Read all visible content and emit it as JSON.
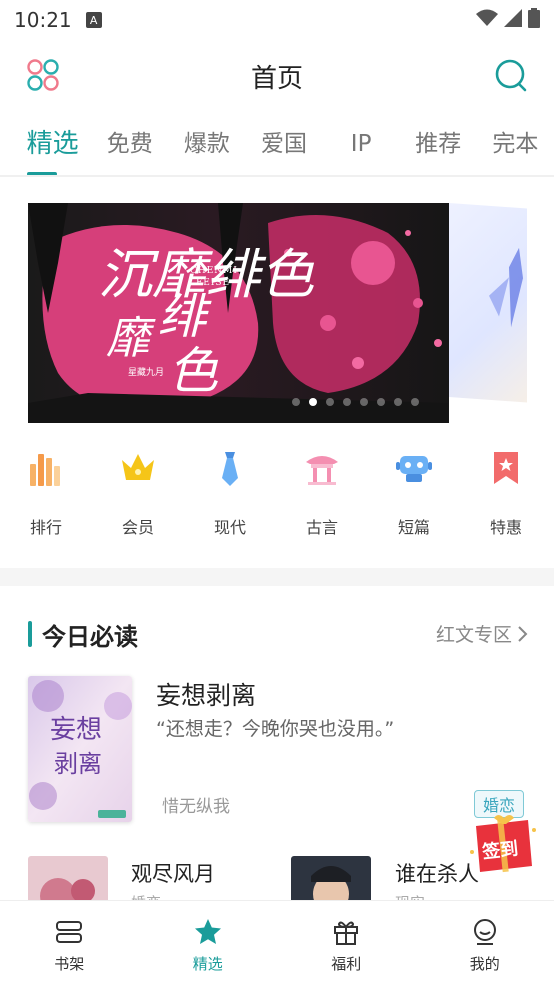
{
  "status": {
    "time": "10:21",
    "a_badge": "A"
  },
  "header": {
    "title": "首页"
  },
  "tabs": [
    {
      "label": "精选",
      "active": true
    },
    {
      "label": "免费"
    },
    {
      "label": "爆款"
    },
    {
      "label": "爱国"
    },
    {
      "label": "IP"
    },
    {
      "label": "推荐"
    },
    {
      "label": "完本"
    }
  ],
  "banner": {
    "title_art": "沉靡绯色",
    "subtitle": "CHENMI FEISE",
    "author_mark": "星藏九月",
    "slide_count": 8,
    "active_slide": 1
  },
  "categories": [
    {
      "label": "排行",
      "icon": "ranking-icon"
    },
    {
      "label": "会员",
      "icon": "crown-icon"
    },
    {
      "label": "现代",
      "icon": "tie-icon"
    },
    {
      "label": "古言",
      "icon": "pavilion-icon"
    },
    {
      "label": "短篇",
      "icon": "robot-icon"
    },
    {
      "label": "特惠",
      "icon": "discount-ribbon-icon"
    }
  ],
  "section": {
    "title": "今日必读",
    "more": "红文专区"
  },
  "featured_book": {
    "title": "妄想剥离",
    "cover_text": "妄想剥离",
    "quote": "“还想走？今晚你哭也没用。”",
    "author": "惜无纵我",
    "tag": "婚恋"
  },
  "books": [
    {
      "title": "观尽风月",
      "sub": "婚恋"
    },
    {
      "title": "谁在杀人",
      "sub": "现实"
    }
  ],
  "signin": {
    "label": "签到"
  },
  "bottom_nav": [
    {
      "label": "书架",
      "icon": "bookshelf-icon"
    },
    {
      "label": "精选",
      "icon": "star-icon",
      "active": true
    },
    {
      "label": "福利",
      "icon": "gift-icon"
    },
    {
      "label": "我的",
      "icon": "profile-icon"
    }
  ],
  "colors": {
    "accent": "#1a9c9a",
    "banner_pink": "#e0467f"
  }
}
